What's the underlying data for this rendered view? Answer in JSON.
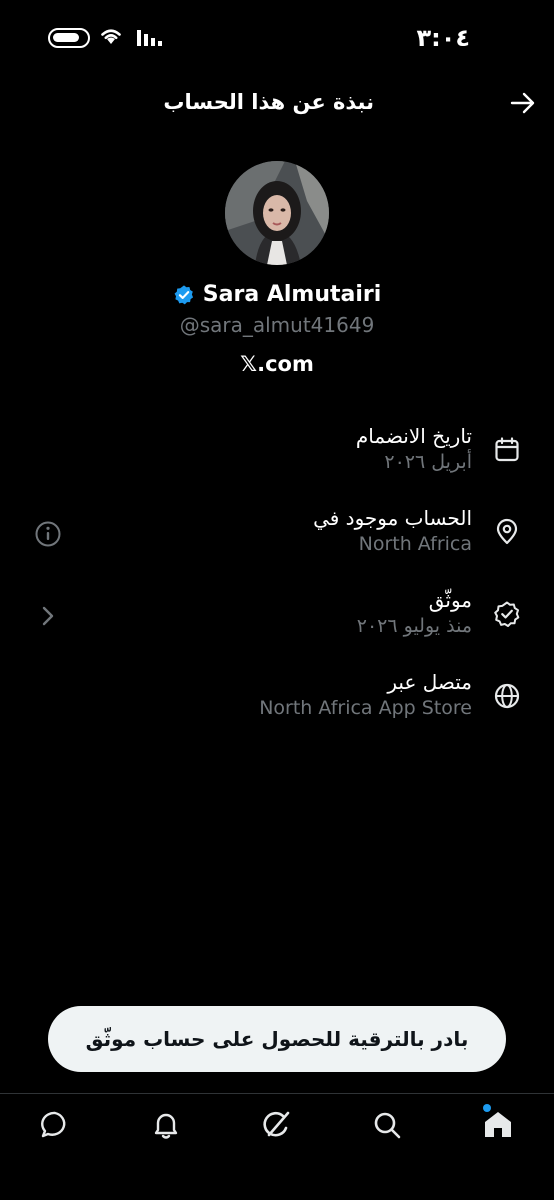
{
  "status_bar": {
    "time": "٣:٠٤"
  },
  "header": {
    "title": "نبذة عن هذا الحساب"
  },
  "profile": {
    "name": "Sara Almutairi",
    "handle": "@sara_almut41649",
    "site": "𝕏.com"
  },
  "info": [
    {
      "label": "تاريخ الانضمام",
      "value": "أبريل ٢٠٢٦",
      "icon": "calendar-icon"
    },
    {
      "label": "الحساب موجود في",
      "value": "North Africa",
      "icon": "location-pin-icon"
    },
    {
      "label": "موثّق",
      "value": "منذ يوليو ٢٠٢٦",
      "icon": "verified-badge-icon"
    },
    {
      "label": "متصل عبر",
      "value": "North Africa App Store",
      "icon": "globe-icon"
    }
  ],
  "upgrade_button": {
    "label": "بادر بالترقية للحصول على حساب موثّق"
  },
  "nav": [
    "home-icon",
    "search-icon",
    "grok-icon",
    "notifications-icon",
    "messages-icon"
  ],
  "colors": {
    "background": "#000000",
    "accent": "#1d9bf0",
    "secondary_text": "#71767b"
  }
}
